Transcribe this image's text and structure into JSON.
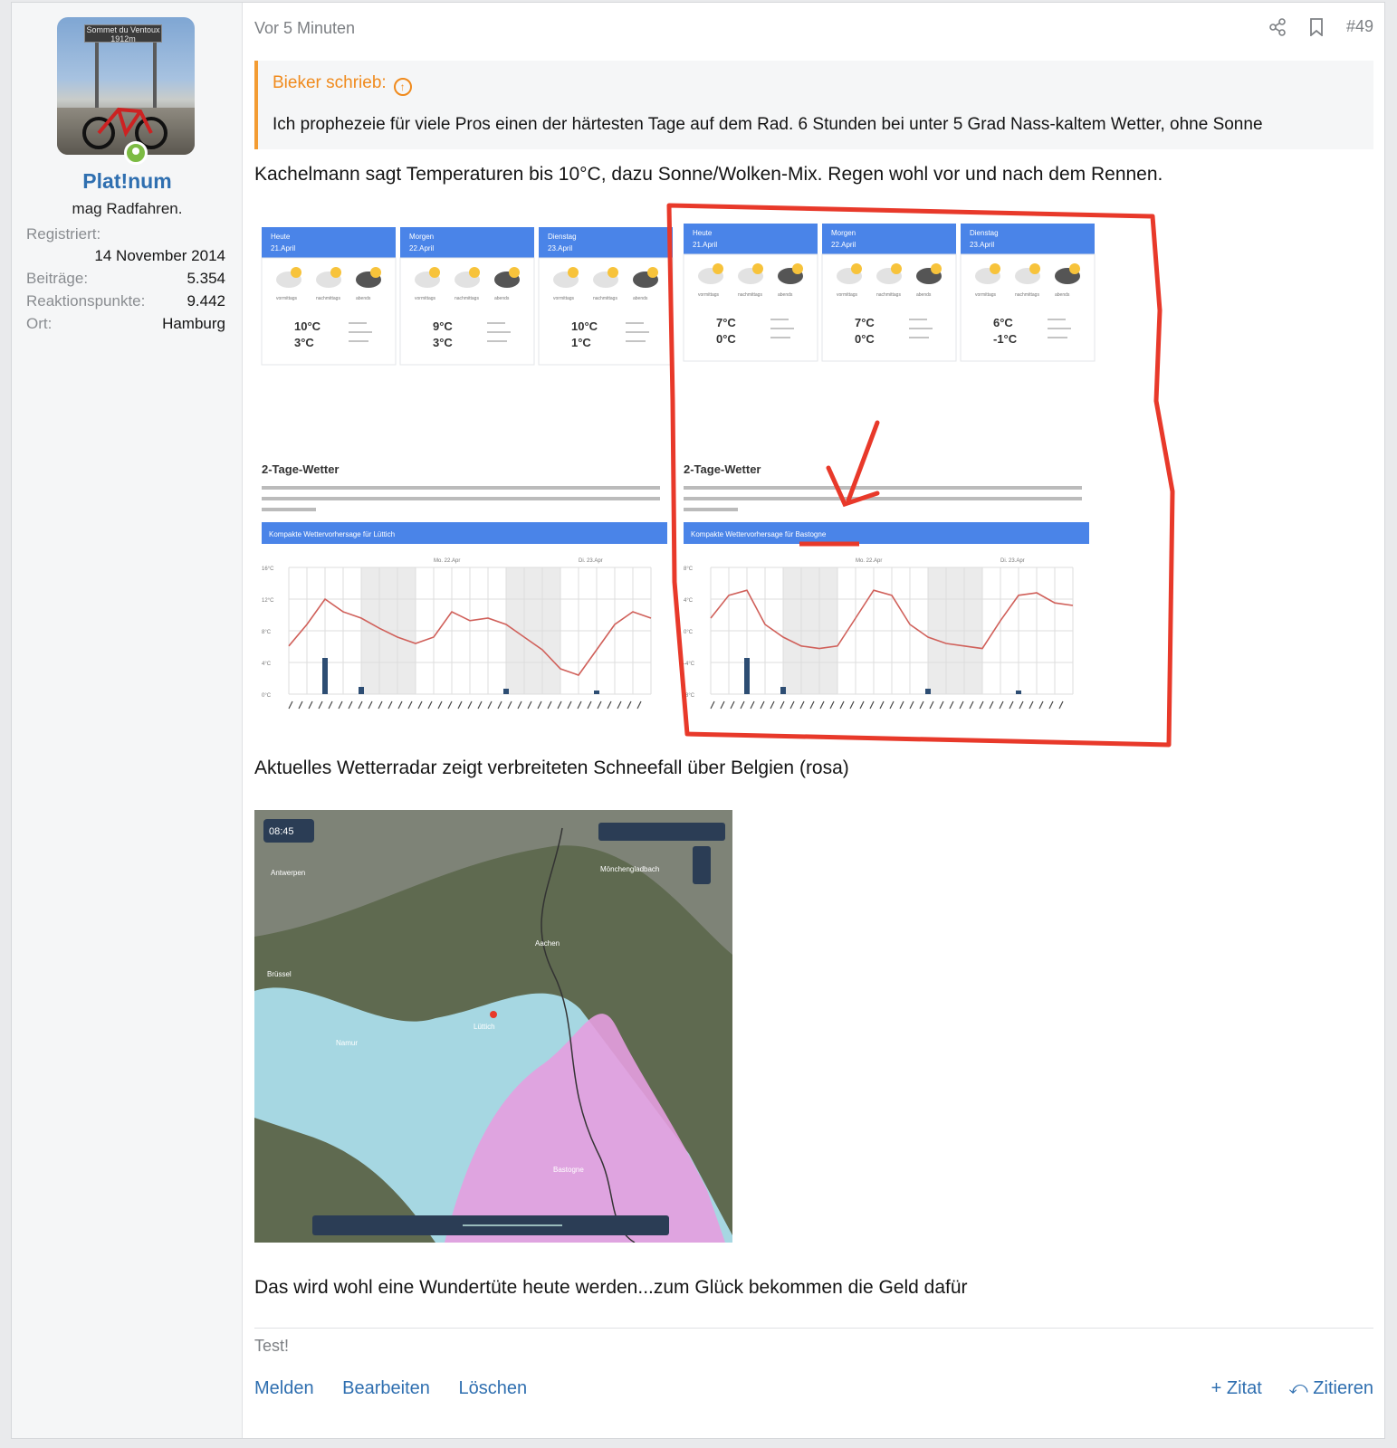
{
  "author": {
    "name": "Plat!num",
    "title": "mag Radfahren.",
    "avatar_sign": "Sommet du Ventoux 1912m",
    "stats": [
      {
        "label": "Registriert:",
        "value": "14 November 2014"
      },
      {
        "label": "Beiträge:",
        "value": "5.354"
      },
      {
        "label": "Reaktionspunkte:",
        "value": "9.442"
      },
      {
        "label": "Ort:",
        "value": "Hamburg"
      }
    ]
  },
  "post": {
    "time": "Vor 5 Minuten",
    "number": "#49",
    "quote": {
      "author": "Bieker schrieb:",
      "text": "Ich prophezeie für viele Pros einen der härtesten Tage auf dem Rad. 6 Stunden bei unter 5 Grad Nass-kaltem Wetter, ohne Sonne"
    },
    "paragraph1": "Kachelmann sagt Temperaturen bis 10°C, dazu Sonne/Wolken-Mix. Regen wohl vor und nach dem Rennen.",
    "paragraph2": "Aktuelles Wetterradar zeigt verbreiteten Schneefall über Belgien (rosa)",
    "paragraph3": "Das wird wohl eine Wundertüte heute werden...zum Glück bekommen die Geld dafür",
    "signature": "Test!",
    "actions_left": [
      "Melden",
      "Bearbeiten",
      "Löschen"
    ],
    "actions_right": [
      "+ Zitat",
      "Zitieren"
    ]
  },
  "weather": {
    "panels": [
      {
        "days": [
          {
            "name": "Heute",
            "date": "21.April",
            "max": "10°C",
            "min": "3°C"
          },
          {
            "name": "Morgen",
            "date": "22.April",
            "max": "9°C",
            "min": "3°C"
          },
          {
            "name": "Dienstag",
            "date": "23.April",
            "max": "10°C",
            "min": "1°C"
          }
        ],
        "subtitle": "Kompakte Wettervorhersage für Lüttich",
        "yticks": [
          "16°C",
          "12°C",
          "8°C",
          "4°C",
          "0°C"
        ]
      },
      {
        "days": [
          {
            "name": "Heute",
            "date": "21.April",
            "max": "7°C",
            "min": "0°C"
          },
          {
            "name": "Morgen",
            "date": "22.April",
            "max": "7°C",
            "min": "0°C"
          },
          {
            "name": "Dienstag",
            "date": "23.April",
            "max": "6°C",
            "min": "-1°C"
          }
        ],
        "subtitle": "Kompakte Wettervorhersage für Bastogne",
        "yticks": [
          "8°C",
          "4°C",
          "0°C",
          "-4°C",
          "-8°C"
        ]
      }
    ],
    "section_title": "2-Tage-Wetter",
    "periods": [
      "vormittags",
      "nachmittags",
      "abends"
    ],
    "day_labels": [
      "Mo. 22.Apr",
      "Di. 23.Apr"
    ]
  },
  "radar": {
    "time": "08:45",
    "cities": [
      "Antwerpen",
      "Brüssel",
      "Mönchengladbach",
      "Aachen",
      "Lüttich",
      "Namur",
      "Bastogne"
    ]
  },
  "colors": {
    "accent": "#2f6fb0",
    "quote_border": "#f39c33",
    "online": "#7cbb43",
    "annotation": "#e8392a",
    "weather_header": "#4a84e8"
  }
}
